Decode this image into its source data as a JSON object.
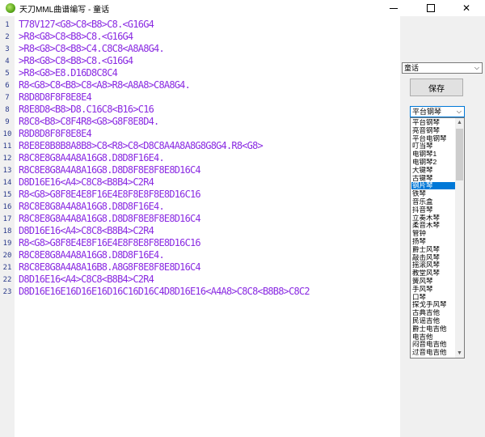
{
  "window": {
    "title": "天刀MML曲谱编写 - 童话",
    "minimize_icon": "minimize-icon",
    "maximize_icon": "maximize-icon",
    "close_glyph": "✕"
  },
  "editor": {
    "lines": [
      {
        "num": "1",
        "text": "T78V127<G8>C8<B8>C8.<G16G4"
      },
      {
        "num": "2",
        "text": ">R8<G8>C8<B8>C8.<G16G4"
      },
      {
        "num": "3",
        "text": ">R8<G8>C8<B8>C4.C8C8<A8A8G4."
      },
      {
        "num": "4",
        "text": ">R8<G8>C8<B8>C8.<G16G4"
      },
      {
        "num": "5",
        "text": ">R8<G8>E8.D16D8C8C4"
      },
      {
        "num": "6",
        "text": "R8<G8>C8<B8>C8<A8>R8<A8A8>C8A8G4."
      },
      {
        "num": "7",
        "text": "R8D8D8F8F8E8E4"
      },
      {
        "num": "8",
        "text": "R8E8D8<B8>D8.C16C8<B16>C16"
      },
      {
        "num": "9",
        "text": "R8C8<B8>C8F4R8<G8>G8F8E8D4."
      },
      {
        "num": "10",
        "text": "R8D8D8F8F8E8E4"
      },
      {
        "num": "11",
        "text": "R8E8E8B8B8A8B8>C8<R8>C8<D8C8A4A8A8G8G8G4.R8<G8>"
      },
      {
        "num": "12",
        "text": "R8C8E8G8A4A8A16G8.D8D8F16E4."
      },
      {
        "num": "13",
        "text": "R8C8E8G8A4A8A16G8.D8D8F8E8F8E8D16C4"
      },
      {
        "num": "14",
        "text": "D8D16E16<A4>C8C8<B8B4>C2R4"
      },
      {
        "num": "15",
        "text": "R8<G8>G8F8E4E8F16E4E8F8E8F8E8D16C16"
      },
      {
        "num": "16",
        "text": "R8C8E8G8A4A8A16G8.D8D8F16E4."
      },
      {
        "num": "17",
        "text": "R8C8E8G8A4A8A16G8.D8D8F8E8F8E8D16C4"
      },
      {
        "num": "18",
        "text": "D8D16E16<A4>C8C8<B8B4>C2R4"
      },
      {
        "num": "19",
        "text": "R8<G8>G8F8E4E8F16E4E8F8E8F8E8D16C16"
      },
      {
        "num": "20",
        "text": "R8C8E8G8A4A8A16G8.D8D8F16E4."
      },
      {
        "num": "21",
        "text": "R8C8E8G8A4A8A16B8.A8G8F8E8F8E8D16C4"
      },
      {
        "num": "22",
        "text": "D8D16E16<A4>C8C8<B8B4>C2R4"
      },
      {
        "num": "23",
        "text": "D8D16E16E16D16E16D16C16D16C4D8D16E16<A4A8>C8C8<B8B8>C8C2"
      }
    ]
  },
  "sidebar": {
    "mode_select_value": "童话",
    "save_label": "保存",
    "instrument_select_value": "平台钢琴",
    "instruments": [
      "平台钢琴",
      "亮音钢琴",
      "平台电钢琴",
      "叮当琴",
      "电钢琴1",
      "电钢琴2",
      "大键琴",
      "古键琴",
      "钢片琴",
      "铁琴",
      "音乐盒",
      "抖音琴",
      "立奏木琴",
      "柔音木琴",
      "管钟",
      "扬琴",
      "爵士风琴",
      "敲击风琴",
      "摇滚风琴",
      "教堂风琴",
      "簧风琴",
      "手风琴",
      "口琴",
      "探戈手风琴",
      "古典吉他",
      "民谣吉他",
      "爵士电吉他",
      "电吉他",
      "闷音电吉他",
      "过音电吉他"
    ],
    "selected_instrument": "钢片琴"
  },
  "colors": {
    "code_text": "#8a2be2",
    "line_number": "#2a3a8a",
    "selection": "#0078d7"
  }
}
